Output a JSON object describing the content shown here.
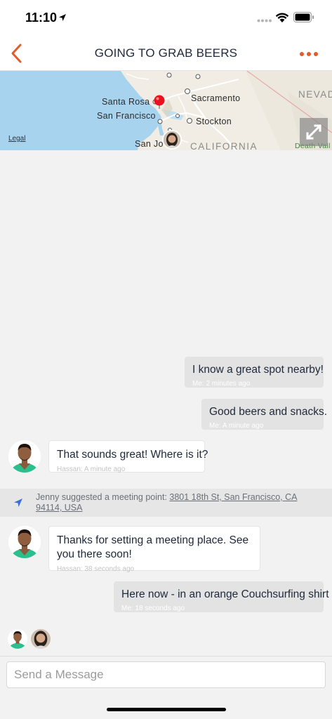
{
  "status_bar": {
    "time": "11:10"
  },
  "header": {
    "title": "GOING TO GRAB BEERS"
  },
  "map": {
    "labels": {
      "santa_rosa": "Santa Rosa",
      "sacramento": "Sacramento",
      "nevada": "NEVAD",
      "san_francisco": "San Francisco",
      "stockton": "Stockton",
      "san_jose": "San Jo",
      "california": "CALIFORNIA",
      "death_valley": "Death Vall"
    },
    "legal": "Legal"
  },
  "messages": [
    {
      "text": "I know a great spot nearby!",
      "meta": "Me: 2 minutes ago"
    },
    {
      "text": "Good beers and snacks.",
      "meta": "Me: A minute ago"
    },
    {
      "text": "That sounds great! Where is it?",
      "meta": "Hassan: A minute ago"
    },
    {
      "text": "Thanks for setting a meeting place. See you there soon!",
      "meta": "Hassan: 38 seconds ago"
    },
    {
      "text": "Here now - in an orange Couchsurfing shirt",
      "meta": "Me: 18 seconds ago"
    }
  ],
  "suggestion": {
    "prefix": "Jenny suggested a meeting point: ",
    "address": "3801 18th St, San Francisco, CA 94114, USA"
  },
  "composer": {
    "placeholder": "Send a Message"
  },
  "colors": {
    "accent": "#e25c2b",
    "outgoing_bubble": "#e3e3e3",
    "incoming_bubble": "#ffffff"
  }
}
